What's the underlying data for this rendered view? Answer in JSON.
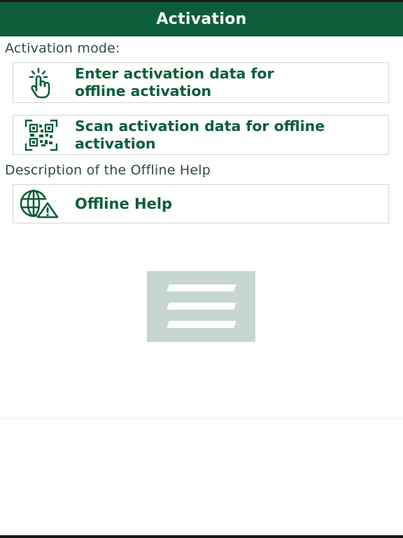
{
  "header": {
    "title": "Activation"
  },
  "activation_mode": {
    "label": "Activation mode:",
    "options": [
      {
        "icon": "touch-hand-icon",
        "line1": "Enter activation data for",
        "line2": "offline activation"
      },
      {
        "icon": "qr-code-scan-icon",
        "line1": "Scan activation data for offline",
        "line2": "activation"
      }
    ]
  },
  "offline_help": {
    "label": "Description of the Offline Help",
    "button_label": "Offline Help",
    "icon": "globe-warning-icon"
  },
  "colors": {
    "brand_green": "#0c5e3a",
    "card_border": "#d2d8d5",
    "loading_tile": "#c6d7cf",
    "label_text": "#2f4d42"
  }
}
